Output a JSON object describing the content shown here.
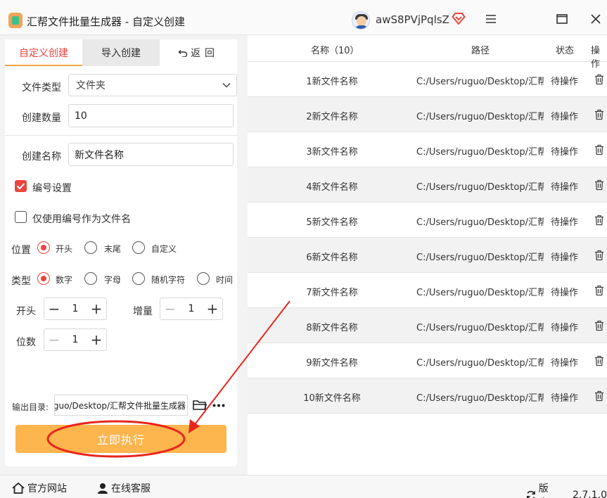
{
  "window": {
    "app_title": "汇帮文件批量生成器 - 自定义创建",
    "user_name": "awS8PVjPqlsZ"
  },
  "tabs": {
    "custom": "自定义创建",
    "import": "导入创建",
    "back": "返回"
  },
  "form": {
    "file_type_label": "文件类型",
    "file_type_value": "文件夹",
    "count_label": "创建数量",
    "count_value": "10",
    "name_label": "创建名称",
    "name_value": "新文件名称",
    "numbering_label": "编号设置",
    "numbering_checked": true,
    "only_number_label": "仅使用编号作为文件名",
    "only_number_checked": false,
    "position_label": "位置",
    "position_options": [
      "开头",
      "末尾",
      "自定义"
    ],
    "position_selected": "开头",
    "type_label": "类型",
    "type_options": [
      "数字",
      "字母",
      "随机字符",
      "时间"
    ],
    "type_selected": "数字",
    "start_label": "开头",
    "start_value": "1",
    "increment_label": "增量",
    "increment_value": "1",
    "digits_label": "位数",
    "digits_value": "1",
    "output_label": "输出目录:",
    "output_path": "C:/Users/ruguo/Desktop/汇帮文件批量生成器",
    "run_button": "立即执行"
  },
  "table": {
    "headers": {
      "name": "名称（10）",
      "path": "路径",
      "status": "状态",
      "action": "操作"
    },
    "rows": [
      {
        "name": "1新文件名称",
        "path": "C:/Users/ruguo/Desktop/汇帮文",
        "status": "待操作"
      },
      {
        "name": "2新文件名称",
        "path": "C:/Users/ruguo/Desktop/汇帮文",
        "status": "待操作"
      },
      {
        "name": "3新文件名称",
        "path": "C:/Users/ruguo/Desktop/汇帮文",
        "status": "待操作"
      },
      {
        "name": "4新文件名称",
        "path": "C:/Users/ruguo/Desktop/汇帮文",
        "status": "待操作"
      },
      {
        "name": "5新文件名称",
        "path": "C:/Users/ruguo/Desktop/汇帮文",
        "status": "待操作"
      },
      {
        "name": "6新文件名称",
        "path": "C:/Users/ruguo/Desktop/汇帮文",
        "status": "待操作"
      },
      {
        "name": "7新文件名称",
        "path": "C:/Users/ruguo/Desktop/汇帮文",
        "status": "待操作"
      },
      {
        "name": "8新文件名称",
        "path": "C:/Users/ruguo/Desktop/汇帮文",
        "status": "待操作"
      },
      {
        "name": "9新文件名称",
        "path": "C:/Users/ruguo/Desktop/汇帮文",
        "status": "待操作"
      },
      {
        "name": "10新文件名称",
        "path": "C:/Users/ruguo/Desktop/汇帮文",
        "status": "待操作"
      }
    ]
  },
  "footer": {
    "website": "官方网站",
    "support": "在线客服",
    "version_label": "版本：",
    "version_value": "2.7.1.0"
  },
  "colors": {
    "accent": "#e8463e",
    "button": "#fdb54e",
    "annotation": "#e8261c"
  },
  "icons": [
    "app-icon",
    "user-avatar",
    "vip-icon",
    "menu-icon",
    "maximize-icon",
    "close-icon",
    "back-arrow-icon",
    "chevron-down-icon",
    "checkbox-icon",
    "folder-icon",
    "more-icon",
    "trash-icon",
    "home-icon",
    "support-icon",
    "refresh-icon"
  ]
}
